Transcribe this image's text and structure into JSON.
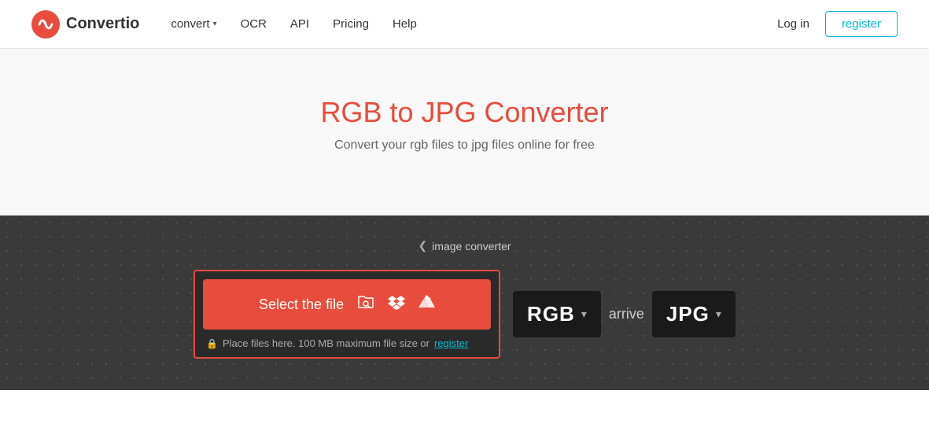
{
  "navbar": {
    "logo_text": "Convertio",
    "links": [
      {
        "label": "convert",
        "has_chevron": true
      },
      {
        "label": "OCR"
      },
      {
        "label": "API"
      },
      {
        "label": "Pricing"
      },
      {
        "label": "Help"
      }
    ],
    "login_label": "Log in",
    "register_label": "register"
  },
  "hero": {
    "title": "RGB to JPG Converter",
    "subtitle": "Convert your rgb files to jpg files online for free"
  },
  "converter": {
    "breadcrumb_chevron": "❮",
    "breadcrumb_text": "image converter",
    "select_file_label": "Select the file",
    "file_hint": "Place files here. 100 MB maximum file size or",
    "register_hint_link": "register",
    "source_format": "RGB",
    "arrow_text": "arrive",
    "target_format": "JPG",
    "icons": {
      "file_browse": "📁",
      "dropbox": "✦",
      "drive": "▲"
    }
  }
}
